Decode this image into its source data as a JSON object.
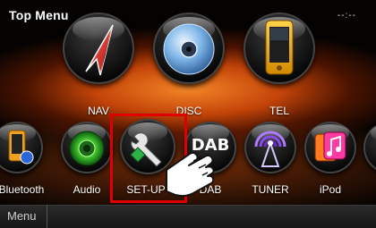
{
  "header": {
    "title": "Top Menu",
    "clock": "--:--"
  },
  "top_row": [
    {
      "key": "nav",
      "label": "NAV",
      "icon": "nav-arrow-icon"
    },
    {
      "key": "disc",
      "label": "DISC",
      "icon": "disc-icon"
    },
    {
      "key": "tel",
      "label": "TEL",
      "icon": "phone-icon"
    }
  ],
  "bottom_row": [
    {
      "key": "bluetooth",
      "label": "Bluetooth",
      "icon": "bluetooth-phone-icon"
    },
    {
      "key": "audio",
      "label": "Audio",
      "icon": "speaker-icon"
    },
    {
      "key": "setup",
      "label": "SET-UP",
      "icon": "wrench-icon"
    },
    {
      "key": "dab",
      "label": "DAB",
      "icon": "dab-icon"
    },
    {
      "key": "tuner",
      "label": "TUNER",
      "icon": "antenna-icon"
    },
    {
      "key": "ipod",
      "label": "iPod",
      "icon": "music-note-icon"
    }
  ],
  "dab_glyph": "DAB",
  "footer": {
    "menu_label": "Menu"
  },
  "colors": {
    "highlight": "#e00000",
    "glow": "#ff7a1a"
  }
}
